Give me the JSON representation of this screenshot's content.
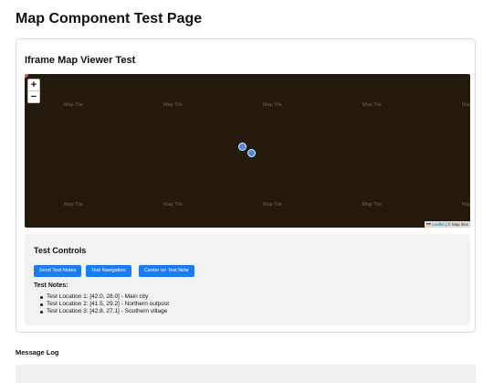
{
  "page": {
    "title": "Map Component Test Page"
  },
  "viewer": {
    "title": "Iframe Map Viewer Test",
    "zoom_in": "+",
    "zoom_out": "−",
    "tile_label": "Map Tile",
    "attribution_leaflet": "Leaflet",
    "attribution_rest": " | © Map tiles",
    "background_color": "#241a0c",
    "pin_color": "#4a89dc"
  },
  "controls": {
    "title": "Test Controls",
    "buttons": [
      "Send Test Notes",
      "Test Navigation",
      "Center on Test Note"
    ],
    "notes_title": "Test Notes:",
    "notes": [
      "Test Location 1: [42.0, 28.0] - Main city",
      "Test Location 2: [41.5, 29.2] - Northern outpost",
      "Test Location 3: [42.8, 27.1] - Southern village"
    ],
    "button_color": "#1a7cf5"
  },
  "log": {
    "title": "Message Log"
  }
}
